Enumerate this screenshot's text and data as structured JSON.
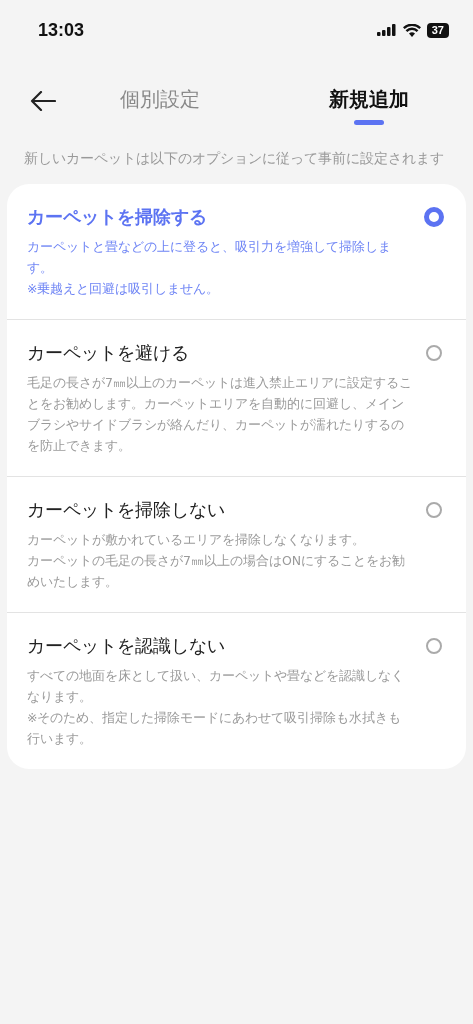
{
  "status_bar": {
    "time": "13:03",
    "battery": "37"
  },
  "tabs": [
    {
      "label": "個別設定",
      "selected": false
    },
    {
      "label": "新規追加",
      "selected": true
    }
  ],
  "intro": "新しいカーペットは以下のオプションに従って事前に設定されます",
  "options": [
    {
      "title": "カーペットを掃除する",
      "selected": true,
      "description": [
        "カーペットと畳などの上に登ると、吸引力を増強して掃除します。",
        "※乗越えと回避は吸引しません。"
      ]
    },
    {
      "title": "カーペットを避ける",
      "selected": false,
      "description": [
        "毛足の長さが7㎜以上のカーペットは進入禁止エリアに設定することをお勧めします。カーペットエリアを自動的に回避し、メインブラシやサイドブラシが絡んだり、カーペットが濡れたりするのを防止できます。"
      ]
    },
    {
      "title": "カーペットを掃除しない",
      "selected": false,
      "description": [
        "カーペットが敷かれているエリアを掃除しなくなります。",
        "カーペットの毛足の長さが7㎜以上の場合はONにすることをお勧めいたします。"
      ]
    },
    {
      "title": "カーペットを認識しない",
      "selected": false,
      "description": [
        "すべての地面を床として扱い、カーペットや畳などを認識しなくなります。",
        "※そのため、指定した掃除モードにあわせて吸引掃除も水拭きも行います。"
      ]
    }
  ]
}
